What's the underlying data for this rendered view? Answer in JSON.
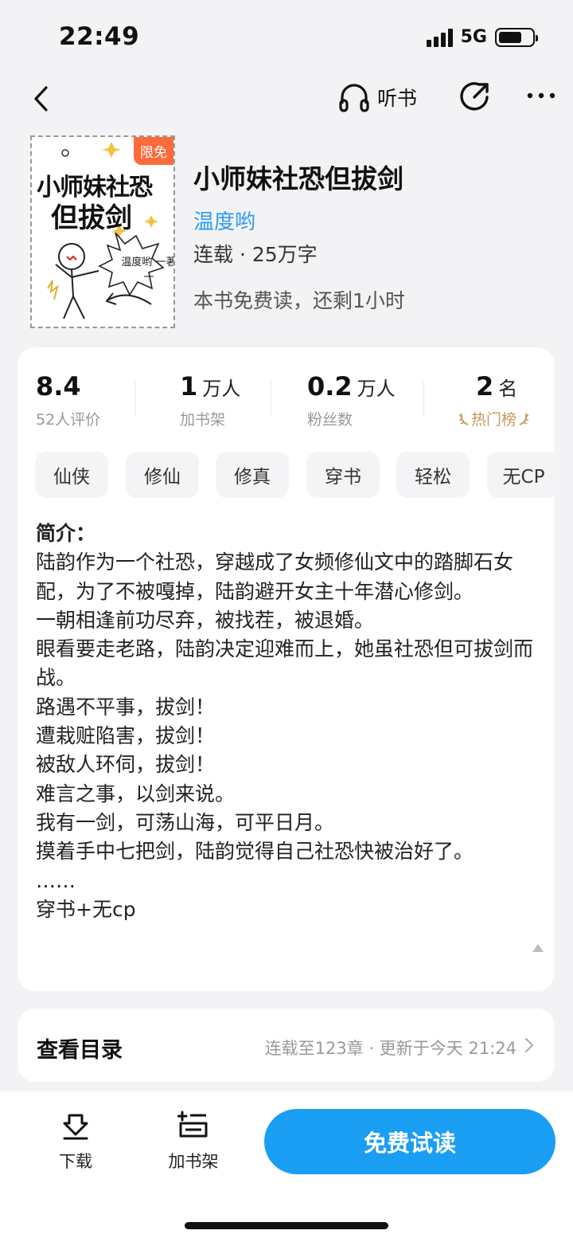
{
  "status": {
    "time": "22:49",
    "network": "5G"
  },
  "nav": {
    "listen_label": "听书"
  },
  "book": {
    "cover_tag": "限免",
    "cover_title_line1": "小师妹社恐",
    "cover_title_line2": "但拔剑",
    "cover_author": "温度哟 一著一",
    "title": "小师妹社恐但拔剑",
    "author": "温度哟",
    "meta": "连载 · 25万字",
    "free_note": "本书免费读，还剩1小时"
  },
  "stats": [
    {
      "value": "8.4",
      "unit": "",
      "label": "52人评价"
    },
    {
      "value": "1",
      "unit": "万人",
      "label": "加书架"
    },
    {
      "value": "0.2",
      "unit": "万人",
      "label": "粉丝数"
    },
    {
      "value": "2",
      "unit": "名",
      "label": "热门榜"
    }
  ],
  "tags": [
    "仙侠",
    "修仙",
    "修真",
    "穿书",
    "轻松",
    "无CP"
  ],
  "intro": {
    "label": "简介：",
    "lines": [
      "陆韵作为一个社恐，穿越成了女频修仙文中的踏脚石女配，为了不被嘎掉，陆韵避开女主十年潜心修剑。",
      "一朝相逢前功尽弃，被找茬，被退婚。",
      "眼看要走老路，陆韵决定迎难而上，她虽社恐但可拔剑而战。",
      "路遇不平事，拔剑！",
      "遭栽赃陷害，拔剑！",
      "被敌人环伺，拔剑！",
      "难言之事，以剑来说。",
      "我有一剑，可荡山海，可平日月。",
      "摸着手中七把剑，陆韵觉得自己社恐快被治好了。",
      "……",
      "穿书+无cp"
    ]
  },
  "toc": {
    "label": "查看目录",
    "info": "连载至123章 · 更新于今天 21:24"
  },
  "bottom": {
    "download_label": "下载",
    "shelf_label": "加书架",
    "read_label": "免费试读"
  },
  "colors": {
    "accent": "#1a9ef3",
    "author": "#2b9bf4",
    "free_tag": "#ff6a3a",
    "rank": "#c59a5a"
  }
}
